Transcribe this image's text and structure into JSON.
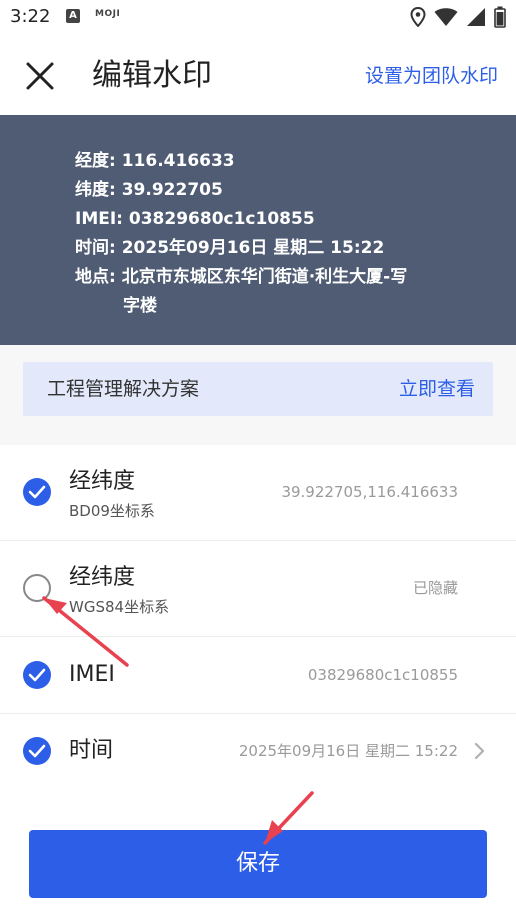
{
  "status_bar": {
    "time": "3:22",
    "app_icon_a": "A",
    "app_icon_moji": "MOJI",
    "icons": [
      "location-icon",
      "wifi-icon",
      "signal-icon",
      "battery-icon"
    ]
  },
  "header": {
    "title": "编辑水印",
    "action": "设置为团队水印",
    "close_icon": "close-icon"
  },
  "watermark_preview": {
    "lines": [
      "经度: 116.416633",
      "纬度: 39.922705",
      "IMEI: 03829680c1c10855",
      "时间: 2025年09月16日 星期二 15:22",
      "地点: 北京市东城区东华门街道·利生大厦-写",
      "字楼"
    ]
  },
  "promo": {
    "text": "工程管理解决方案",
    "link": "立即查看"
  },
  "fields": [
    {
      "title": "经纬度",
      "subtitle": "BD09坐标系",
      "value": "39.922705,116.416633",
      "checked": true
    },
    {
      "title": "经纬度",
      "subtitle": "WGS84坐标系",
      "value": "已隐藏",
      "checked": false
    },
    {
      "title": "IMEI",
      "subtitle": "",
      "value": "03829680c1c10855",
      "checked": true
    },
    {
      "title": "时间",
      "subtitle": "",
      "value": "2025年09月16日 星期二 15:22",
      "checked": true
    }
  ],
  "save_button": {
    "label": "保存"
  },
  "colors": {
    "accent": "#2c5ee8",
    "watermark_bg": "#4f5c73",
    "promo_bg": "#e3e9fb",
    "annotation_arrow": "#e8414f"
  }
}
